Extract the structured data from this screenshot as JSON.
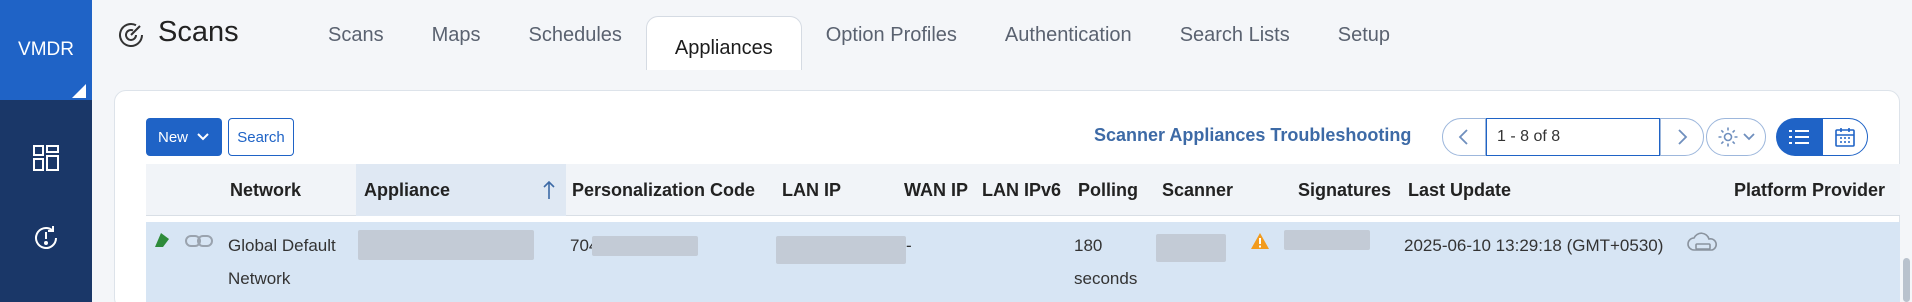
{
  "brand": {
    "label": "VMDR",
    "colors": {
      "primary": "#1f63c6",
      "rail": "#1a3768"
    }
  },
  "rail_icons": [
    "dashboard-icon",
    "history-icon"
  ],
  "header": {
    "app_title": "Scans",
    "app_icon": "scan-radar-icon",
    "tabs": [
      {
        "label": "Scans",
        "active": false
      },
      {
        "label": "Maps",
        "active": false
      },
      {
        "label": "Schedules",
        "active": false
      },
      {
        "label": "Appliances",
        "active": true
      },
      {
        "label": "Option Profiles",
        "active": false
      },
      {
        "label": "Authentication",
        "active": false
      },
      {
        "label": "Search Lists",
        "active": false
      },
      {
        "label": "Setup",
        "active": false
      }
    ]
  },
  "toolbar": {
    "new_label": "New",
    "search_label": "Search",
    "troubleshoot_link": "Scanner Appliances Troubleshooting",
    "pager_value": "1 - 8 of 8"
  },
  "table": {
    "columns": [
      "Network",
      "Appliance",
      "Personalization Code",
      "LAN IP",
      "WAN IP",
      "LAN IPv6",
      "Polling",
      "Scanner",
      "Signatures",
      "Last Update",
      "Platform Provider"
    ],
    "sorted_column": "Appliance",
    "rows": [
      {
        "network": "Global Default",
        "network_line2": "Network",
        "personalization_code_prefix": "704",
        "wan_ip": "-",
        "polling": "180",
        "polling_line2": "seconds",
        "last_update": "2025-06-10 13:29:18 (GMT+0530)"
      }
    ]
  }
}
